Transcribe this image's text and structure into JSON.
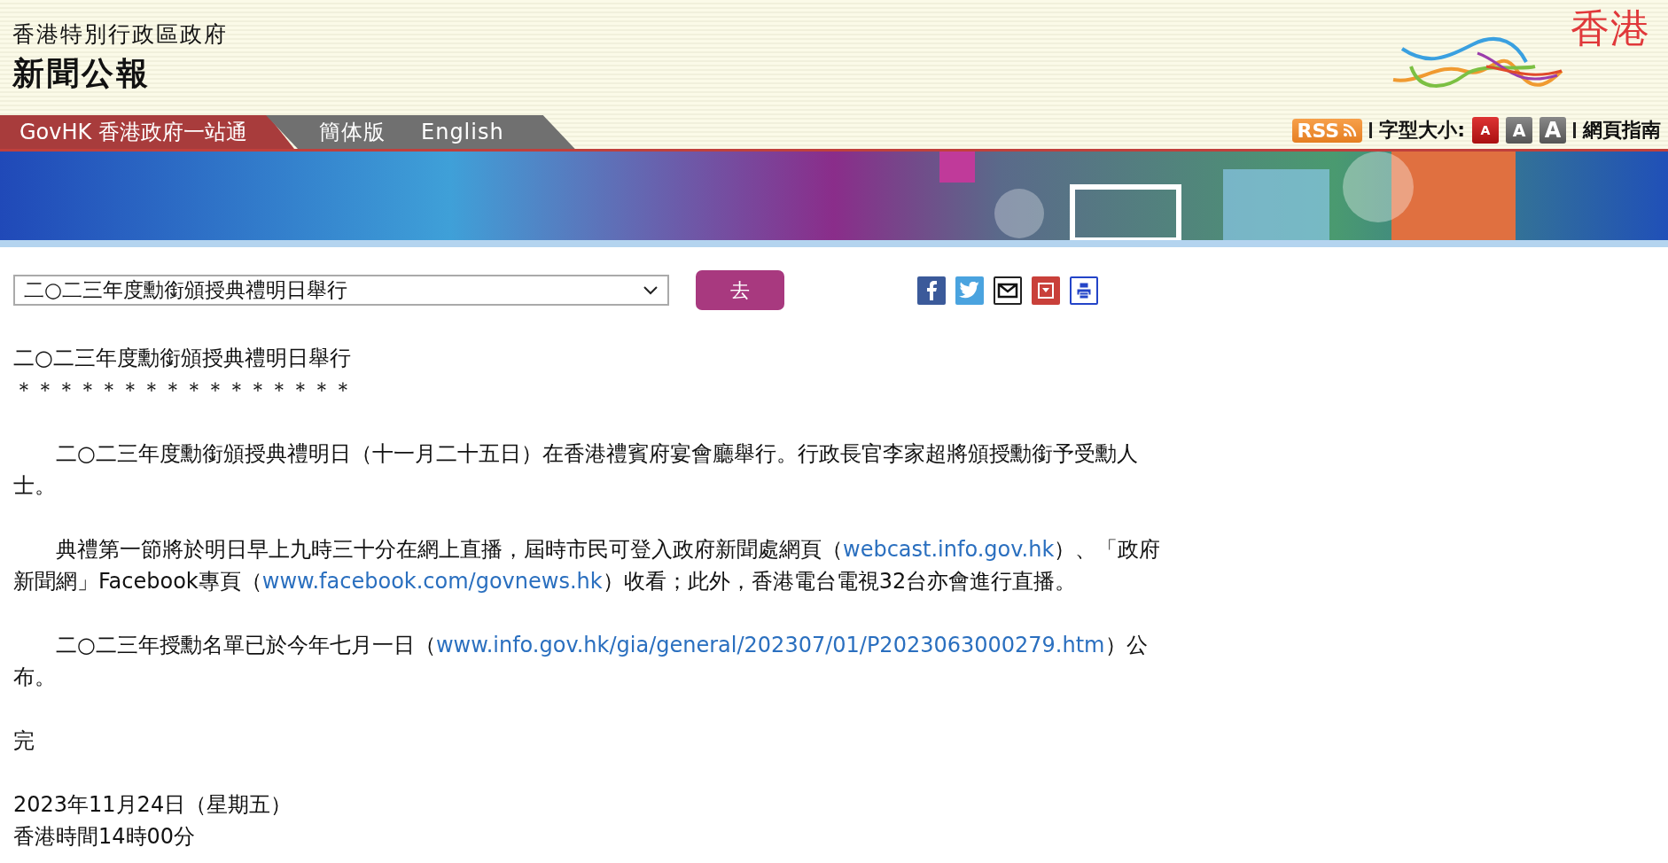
{
  "header": {
    "government": "香港特別行政區政府",
    "title": "新聞公報",
    "logo_text": "香港"
  },
  "nav": {
    "home_link": "GovHK 香港政府一站通",
    "languages": [
      "簡体版",
      "English"
    ]
  },
  "tools": {
    "rss": "RSS",
    "font_size_label": "字型大小:",
    "font_sizes": [
      {
        "label": "A",
        "selected": true
      },
      {
        "label": "A",
        "selected": false
      },
      {
        "label": "A",
        "selected": false
      }
    ],
    "guide": "網頁指南"
  },
  "selector": {
    "value": "二○二三年度勳銜頒授典禮明日舉行",
    "go": "去"
  },
  "article": {
    "title": "二○二三年度勳銜頒授典禮明日舉行",
    "stars": "＊＊＊＊＊＊＊＊＊＊＊＊＊＊＊＊",
    "paragraphs": [
      [
        {
          "kind": "text",
          "text": "二○二三年度勳銜頒授典禮明日（十一月二十五日）在香港禮賓府宴會廳舉行。行政長官李家超將頒授勳銜予受勳人士。"
        }
      ],
      [
        {
          "kind": "text",
          "text": "典禮第一節將於明日早上九時三十分在網上直播，屆時市民可登入政府新聞處網頁（"
        },
        {
          "kind": "link",
          "text": "webcast.info.gov.hk"
        },
        {
          "kind": "text",
          "text": "）、「政府新聞網」Facebook專頁（"
        },
        {
          "kind": "link",
          "text": "www.facebook.com/govnews.hk"
        },
        {
          "kind": "text",
          "text": "）收看；此外，香港電台電視32台亦會進行直播。"
        }
      ],
      [
        {
          "kind": "text",
          "text": "二○二三年授勳名單已於今年七月一日（"
        },
        {
          "kind": "link",
          "text": "www.info.gov.hk/gia/general/202307/01/P2023063000279.htm"
        },
        {
          "kind": "text",
          "text": "）公布。"
        }
      ]
    ],
    "end": "完",
    "date": "2023年11月24日（星期五）",
    "time": "香港時間14時00分"
  }
}
